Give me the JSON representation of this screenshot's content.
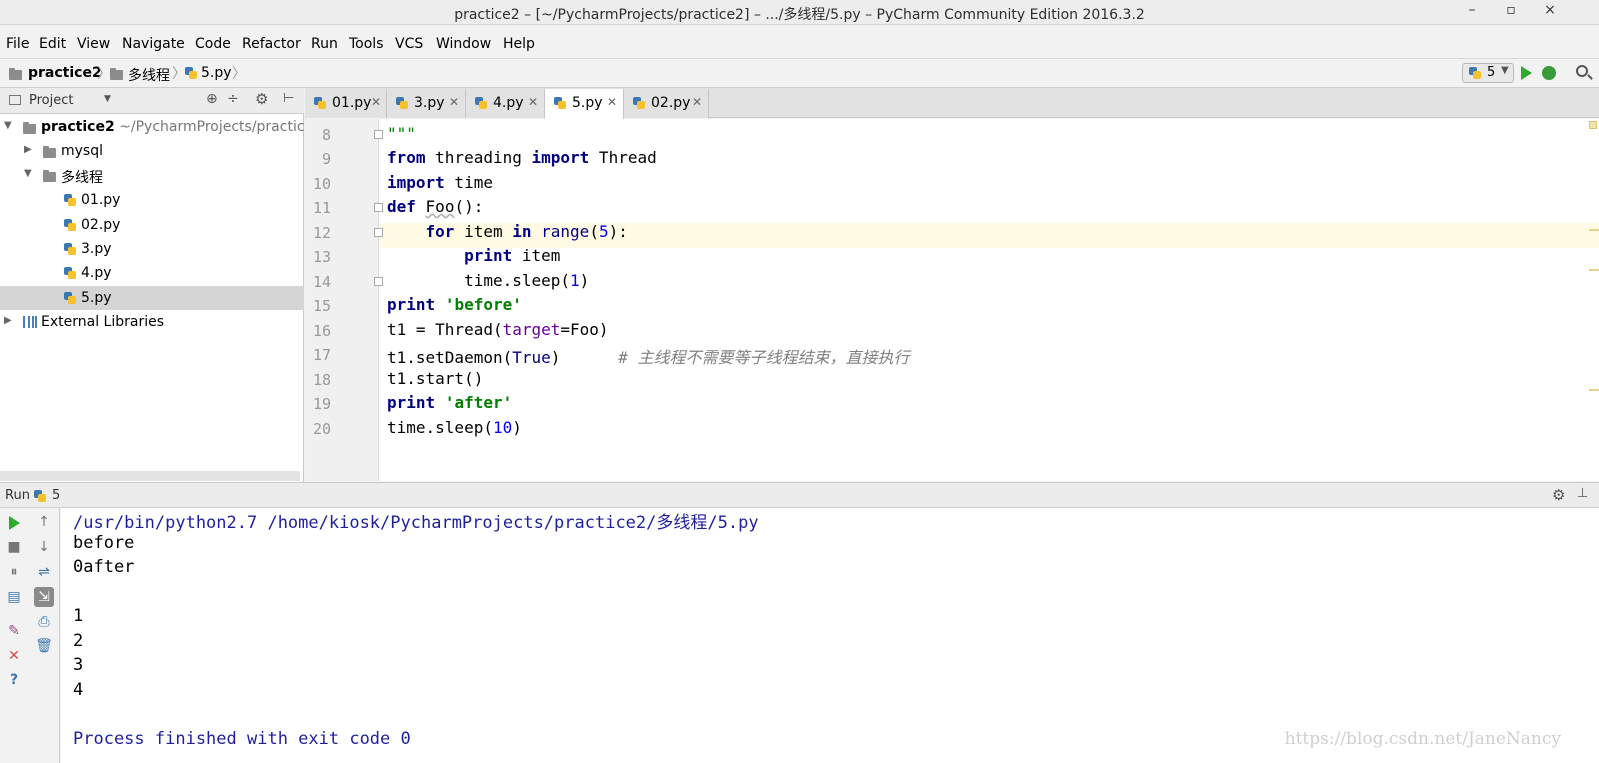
{
  "window": {
    "title": "practice2 – [~/PycharmProjects/practice2] – .../多线程/5.py – PyCharm Community Edition 2016.3.2",
    "minimize": "–",
    "maximize": "▫",
    "close": "×"
  },
  "menu": [
    "File",
    "Edit",
    "View",
    "Navigate",
    "Code",
    "Refactor",
    "Run",
    "Tools",
    "VCS",
    "Window",
    "Help"
  ],
  "breadcrumb": {
    "project": "practice2",
    "folder": "多线程",
    "file": "5.py"
  },
  "run_config": {
    "label": "5"
  },
  "project_panel": {
    "title": "Project",
    "root_name": "practice2",
    "root_path": "~/PycharmProjects/practice2",
    "folders": [
      "mysql",
      "多线程"
    ],
    "files": [
      "01.py",
      "02.py",
      "3.py",
      "4.py",
      "5.py"
    ],
    "external": "External Libraries"
  },
  "tabs": [
    {
      "label": "01.py",
      "active": false
    },
    {
      "label": "3.py",
      "active": false
    },
    {
      "label": "4.py",
      "active": false
    },
    {
      "label": "5.py",
      "active": true
    },
    {
      "label": "02.py",
      "active": false
    }
  ],
  "editor": {
    "line_numbers": [
      "8",
      "9",
      "10",
      "11",
      "12",
      "13",
      "14",
      "15",
      "16",
      "17",
      "18",
      "19",
      "20"
    ],
    "lines": [
      "\"\"\"",
      "from threading import Thread",
      "import time",
      "def Foo():",
      "    for item in range(5):",
      "        print item",
      "        time.sleep(1)",
      "print 'before'",
      "t1 = Thread(target=Foo)",
      "t1.setDaemon(True)      # 主线程不需要等子线程结束，直接执行",
      "t1.start()",
      "print 'after'",
      "time.sleep(10)"
    ]
  },
  "run_panel": {
    "title": "Run",
    "config": "5",
    "output": [
      "/usr/bin/python2.7 /home/kiosk/PycharmProjects/practice2/多线程/5.py",
      "before",
      "0after",
      "",
      "1",
      "2",
      "3",
      "4",
      "",
      "Process finished with exit code 0"
    ],
    "watermark": "https://blog.csdn.net/JaneNancy"
  },
  "colors": {
    "keyword": "#000080",
    "string": "#008000",
    "number": "#0000ff",
    "comment": "#808080",
    "caret_line": "#fffae3",
    "run_green": "#2eaa2e"
  }
}
